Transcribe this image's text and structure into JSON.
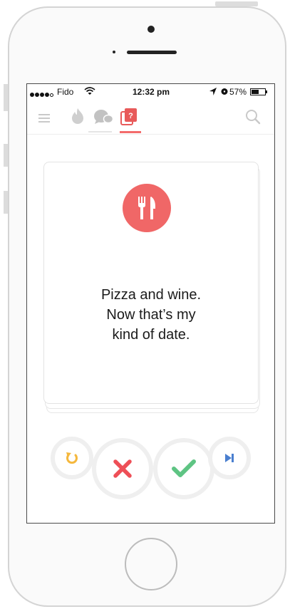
{
  "status_bar": {
    "carrier": "Fido",
    "time": "12:32 pm",
    "battery_percent": "57%",
    "battery_level": 0.57
  },
  "navbar": {
    "icons": [
      "menu-icon",
      "flame-icon",
      "chat-icon",
      "quiz-card-icon",
      "search-icon"
    ],
    "active_tab": "quiz-card-icon",
    "quiz_icon_glyph": "?"
  },
  "card": {
    "icon": "fork-knife-icon",
    "text": "Pizza and wine.\nNow that’s my\nkind of date."
  },
  "actions": [
    {
      "name": "undo",
      "icon": "undo-icon"
    },
    {
      "name": "nope",
      "icon": "x-icon"
    },
    {
      "name": "like",
      "icon": "check-icon"
    },
    {
      "name": "skip",
      "icon": "skip-icon"
    }
  ],
  "colors": {
    "accent": "#f06767",
    "nope": "#ee4f57",
    "like": "#5ec483",
    "undo": "#f5b83d",
    "skip": "#4a7fcf",
    "nav_icon": "#c9c9c9"
  }
}
